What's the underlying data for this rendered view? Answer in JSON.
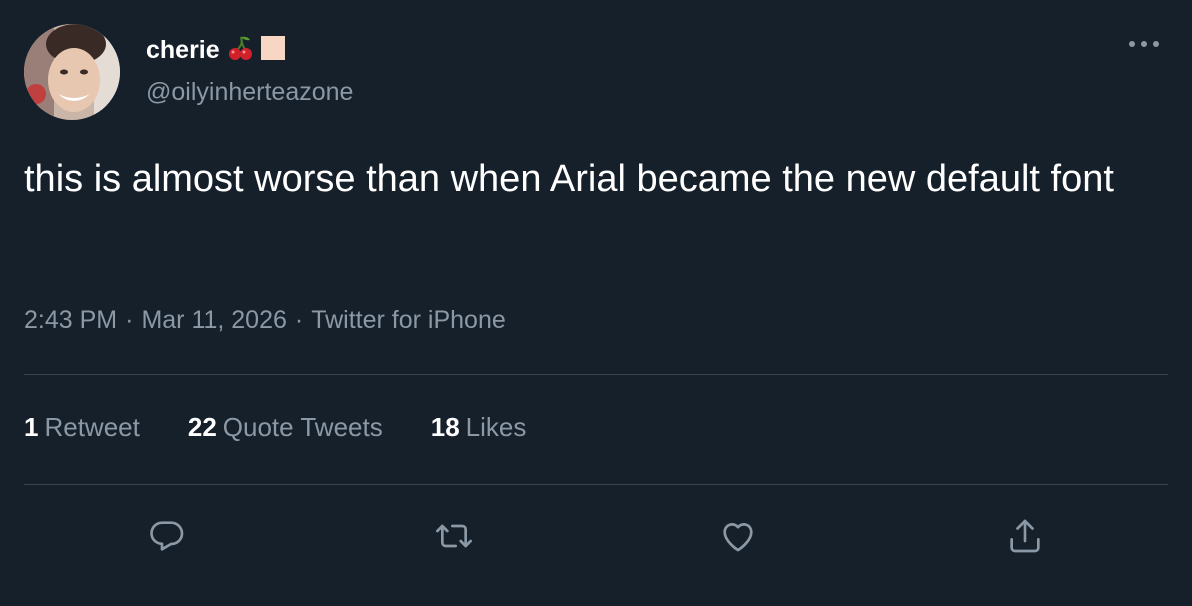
{
  "author": {
    "display_name": "cherie",
    "emojis": [
      "cherries-emoji",
      "peach-square-emoji"
    ],
    "handle": "@oilyinherteazone"
  },
  "tweet": {
    "text": "this is almost worse than when Arial became the new default font"
  },
  "meta": {
    "time": "2:43 PM",
    "separator": "·",
    "date": "Mar 11, 2026",
    "source": "Twitter for iPhone"
  },
  "stats": [
    {
      "count": "1",
      "label": "Retweet"
    },
    {
      "count": "22",
      "label": "Quote Tweets"
    },
    {
      "count": "18",
      "label": "Likes"
    }
  ],
  "actions": [
    "reply-icon",
    "retweet-icon",
    "like-icon",
    "share-icon"
  ],
  "colors": {
    "background": "#15202b",
    "primary_text": "#ffffff",
    "secondary_text": "#8b98a5",
    "divider": "#38444d",
    "icon": "#8b98a5"
  }
}
